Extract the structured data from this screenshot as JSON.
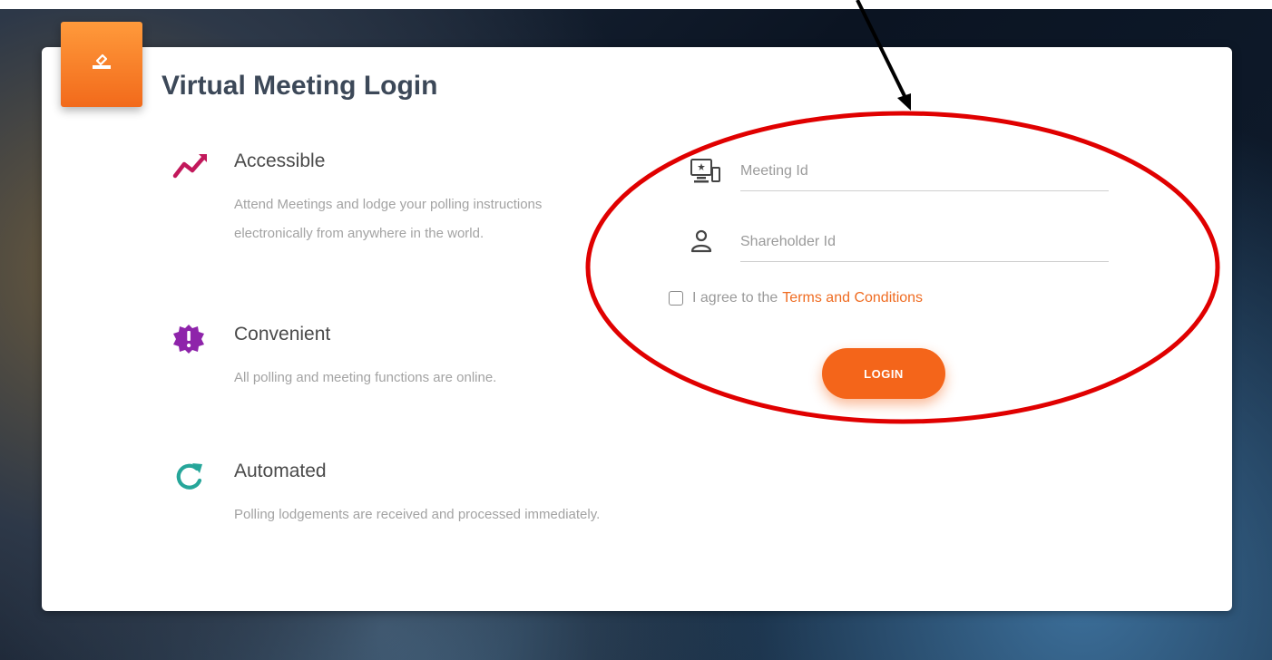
{
  "page": {
    "title": "Virtual Meeting Login"
  },
  "features": [
    {
      "icon": "trend-line-icon",
      "heading": "Accessible",
      "description": "Attend Meetings and lodge your polling instructions electronically from anywhere in the world.",
      "color": "#c2185b"
    },
    {
      "icon": "alert-badge-icon",
      "heading": "Convenient",
      "description": "All polling and meeting functions are online.",
      "color": "#8e24aa"
    },
    {
      "icon": "refresh-icon",
      "heading": "Automated",
      "description": "Polling lodgements are received and processed immediately.",
      "color": "#26a69a"
    }
  ],
  "form": {
    "meeting_id": {
      "placeholder": "Meeting Id",
      "value": "",
      "icon": "devices-icon"
    },
    "shareholder_id": {
      "placeholder": "Shareholder Id",
      "value": "",
      "icon": "person-icon"
    },
    "agree_text": "I agree to the",
    "terms_link": "Terms and Conditions",
    "agree_checked": false,
    "login_label": "LOGIN"
  },
  "colors": {
    "accent": "#f4651a",
    "annotation": "#e00000"
  }
}
